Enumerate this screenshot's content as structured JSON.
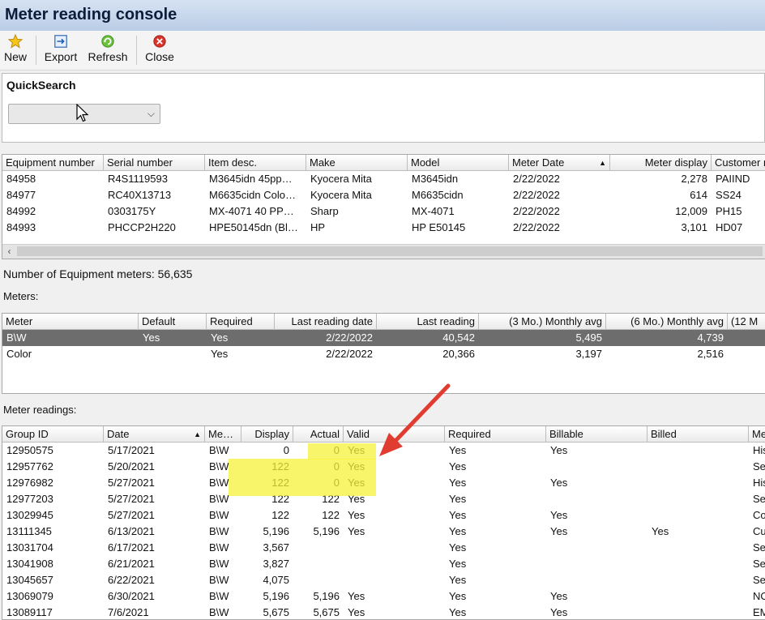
{
  "window": {
    "title": "Meter reading console"
  },
  "toolbar": {
    "new_label": "New",
    "export_label": "Export",
    "refresh_label": "Refresh",
    "close_label": "Close"
  },
  "quicksearch": {
    "title": "QuickSearch",
    "value": ""
  },
  "equipment": {
    "columns": [
      "Equipment number",
      "Serial number",
      "Item desc.",
      "Make",
      "Model",
      "Meter Date",
      "Meter display",
      "Customer r"
    ],
    "rows": [
      [
        "84958",
        "R4S1119593",
        "M3645idn 45pp…",
        "Kyocera Mita",
        "M3645idn",
        "2/22/2022",
        "2,278",
        "PAIIND"
      ],
      [
        "84977",
        "RC40X13713",
        "M6635cidn Colo…",
        "Kyocera Mita",
        "M6635cidn",
        "2/22/2022",
        "614",
        "SS24"
      ],
      [
        "84992",
        "0303175Y",
        "MX-4071 40 PP…",
        "Sharp",
        "MX-4071",
        "2/22/2022",
        "12,009",
        "PH15"
      ],
      [
        "84993",
        "PHCCP2H220",
        "HPE50145dn (Bl…",
        "HP",
        "HP E50145",
        "2/22/2022",
        "3,101",
        "HD07"
      ]
    ],
    "count_label": "Number of Equipment meters: 56,635"
  },
  "meters": {
    "section_label": "Meters:",
    "columns": [
      "Meter",
      "Default",
      "Required",
      "Last reading date",
      "Last reading",
      "(3 Mo.) Monthly avg",
      "(6 Mo.) Monthly avg",
      "(12 M"
    ],
    "rows": [
      [
        "B\\W",
        "Yes",
        "Yes",
        "2/22/2022",
        "40,542",
        "5,495",
        "4,739",
        ""
      ],
      [
        "Color",
        "",
        "Yes",
        "2/22/2022",
        "20,366",
        "3,197",
        "2,516",
        ""
      ]
    ]
  },
  "readings": {
    "section_label": "Meter readings:",
    "columns": [
      "Group ID",
      "Date",
      "Me…",
      "Display",
      "Actual",
      "Valid",
      "Required",
      "Billable",
      "Billed",
      "Me"
    ],
    "rows": [
      [
        "12950575",
        "5/17/2021",
        "B\\W",
        "0",
        "0",
        "Yes",
        "Yes",
        "Yes",
        "",
        "His"
      ],
      [
        "12957762",
        "5/20/2021",
        "B\\W",
        "122",
        "0",
        "Yes",
        "Yes",
        "",
        "",
        "Se"
      ],
      [
        "12976982",
        "5/27/2021",
        "B\\W",
        "122",
        "0",
        "Yes",
        "Yes",
        "Yes",
        "",
        "His"
      ],
      [
        "12977203",
        "5/27/2021",
        "B\\W",
        "122",
        "122",
        "Yes",
        "Yes",
        "",
        "",
        "Se"
      ],
      [
        "13029945",
        "5/27/2021",
        "B\\W",
        "122",
        "122",
        "Yes",
        "Yes",
        "Yes",
        "",
        "Co"
      ],
      [
        "13111345",
        "6/13/2021",
        "B\\W",
        "5,196",
        "5,196",
        "Yes",
        "Yes",
        "Yes",
        "Yes",
        "Cu"
      ],
      [
        "13031704",
        "6/17/2021",
        "B\\W",
        "3,567",
        "",
        "",
        "Yes",
        "",
        "",
        "Se"
      ],
      [
        "13041908",
        "6/21/2021",
        "B\\W",
        "3,827",
        "",
        "",
        "Yes",
        "",
        "",
        "Se"
      ],
      [
        "13045657",
        "6/22/2021",
        "B\\W",
        "4,075",
        "",
        "",
        "Yes",
        "",
        "",
        "Se"
      ],
      [
        "13069079",
        "6/30/2021",
        "B\\W",
        "5,196",
        "5,196",
        "Yes",
        "Yes",
        "Yes",
        "",
        "NO"
      ],
      [
        "13089117",
        "7/6/2021",
        "B\\W",
        "5,675",
        "5,675",
        "Yes",
        "Yes",
        "Yes",
        "",
        "EM"
      ]
    ]
  },
  "colors": {
    "highlight": "#f7f23a",
    "arrow": "#e03c31",
    "selected_row": "#6d6d6d"
  }
}
